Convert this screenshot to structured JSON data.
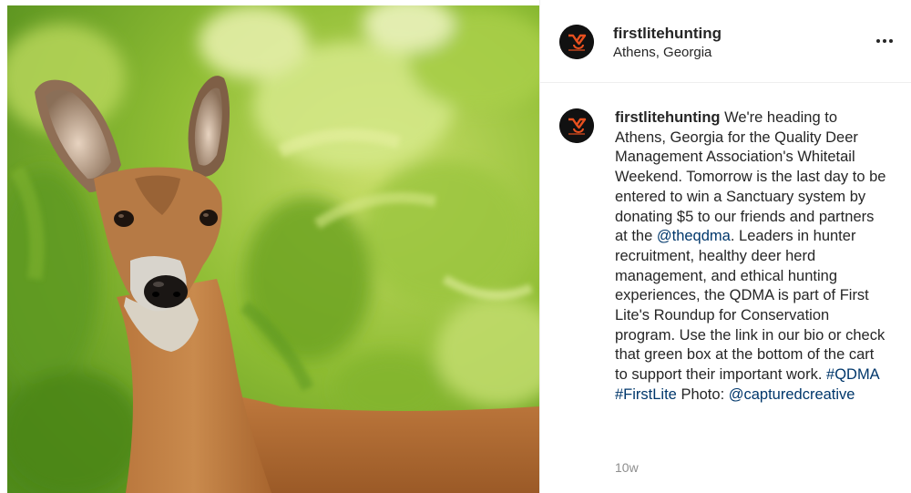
{
  "post": {
    "username": "firstlitehunting",
    "location": "Athens, Georgia",
    "avatar_text": "FIRST LITE",
    "more_options_icon": "more-horizontal-icon",
    "photo_description_icon": "deer-photo",
    "colors": {
      "text": "#262626",
      "link": "#00376b",
      "muted": "#8e8e8e",
      "avatar_bg": "#111111",
      "logo_accent": "#e8501f"
    }
  },
  "caption": {
    "username": "firstlitehunting",
    "part1": " We're heading to Athens, Georgia for the Quality Deer Management Association's Whitetail Weekend. Tomorrow is the last day to be entered to win a Sanctuary system by donating $5 to our friends and partners at the ",
    "mention1": "@theqdma",
    "part2": ". Leaders in hunter recruitment, healthy deer herd management, and ethical hunting experiences, the QDMA is part of First Lite's Roundup for Conservation program. Use the link in our bio or check that green box at the bottom of the cart to support their important work. ",
    "hashtag1": "#QDMA",
    "space": " ",
    "hashtag2": "#FirstLite",
    "part3": " Photo: ",
    "mention2": "@capturedcreative"
  },
  "timestamp": "10w"
}
